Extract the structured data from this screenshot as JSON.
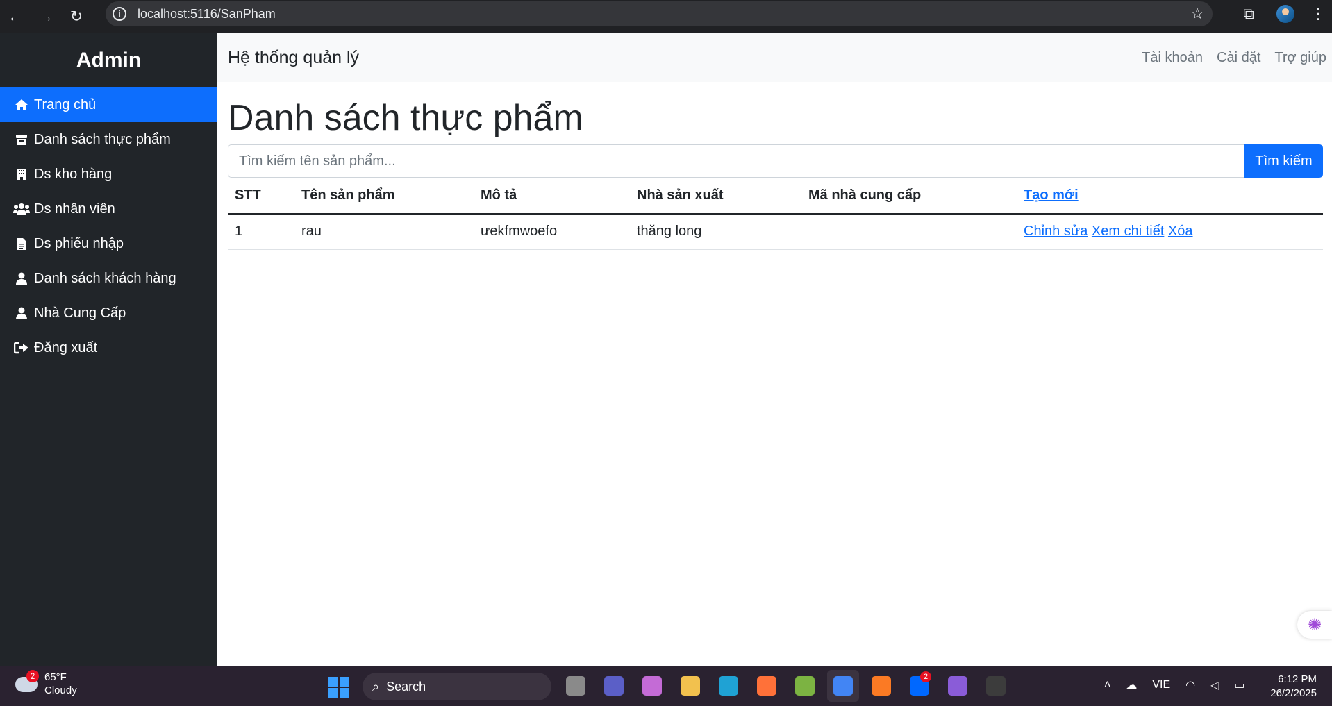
{
  "browser": {
    "url": "localhost:5116/SanPham",
    "icons": [
      "back-arrow-icon",
      "forward-arrow-icon",
      "reload-icon",
      "info-icon",
      "star-icon",
      "extensions-icon",
      "profile-avatar",
      "more-vert-icon"
    ]
  },
  "sidebar": {
    "brand": "Admin",
    "items": [
      {
        "label": "Trang chủ",
        "icon": "home-icon",
        "active": true
      },
      {
        "label": "Danh sách thực phẩm",
        "icon": "box-icon"
      },
      {
        "label": "Ds kho hàng",
        "icon": "building-icon"
      },
      {
        "label": "Ds nhân viên",
        "icon": "people-icon"
      },
      {
        "label": "Ds phiếu nhập",
        "icon": "document-icon"
      },
      {
        "label": "Danh sách khách hàng",
        "icon": "person-icon"
      },
      {
        "label": "Nhà Cung Cấp",
        "icon": "person-icon"
      },
      {
        "label": "Đăng xuất",
        "icon": "logout-icon"
      }
    ]
  },
  "topnav": {
    "title": "Hệ thống quản lý",
    "links": [
      "Tài khoản",
      "Cài đặt",
      "Trợ giúp"
    ]
  },
  "main": {
    "title": "Danh sách thực phẩm",
    "search": {
      "placeholder": "Tìm kiếm tên sản phẩm...",
      "value": "",
      "button": "Tìm kiếm"
    },
    "table": {
      "headers": [
        "STT",
        "Tên sản phẩm",
        "Mô tả",
        "Nhà sản xuất",
        "Mã nhà cung cấp"
      ],
      "create_link": "Tạo mới",
      "rows": [
        {
          "stt": "1",
          "ten": "rau",
          "mota": "ưekfmwoefo",
          "nsx": "thăng long",
          "ma_ncc": "",
          "actions": [
            "Chỉnh sửa",
            "Xem chi tiết",
            "Xóa"
          ]
        }
      ]
    }
  },
  "taskbar": {
    "weather": {
      "temp": "65°F",
      "condition": "Cloudy",
      "badge": "2"
    },
    "search_label": "Search",
    "apps": [
      {
        "name": "task-view-icon",
        "color": "#8a8a8a"
      },
      {
        "name": "teams-icon",
        "color": "#5b5fc7"
      },
      {
        "name": "copilot-icon",
        "color": "#c46bd6"
      },
      {
        "name": "file-explorer-icon",
        "color": "#f2c14e"
      },
      {
        "name": "edge-icon",
        "color": "#1fa2d4"
      },
      {
        "name": "firefox-icon",
        "color": "#ff7139"
      },
      {
        "name": "snipping-tool-icon",
        "color": "#7cb342"
      },
      {
        "name": "chrome-icon",
        "color": "#4285f4",
        "active": true
      },
      {
        "name": "xampp-icon",
        "color": "#fb7a24"
      },
      {
        "name": "zalo-icon",
        "color": "#0068ff",
        "badge": "2"
      },
      {
        "name": "visual-studio-icon",
        "color": "#8a5cd8"
      },
      {
        "name": "terminal-icon",
        "color": "#3c3c3c"
      }
    ],
    "tray": {
      "language": "VIE"
    },
    "clock": {
      "time": "6:12 PM",
      "date": "26/2/2025"
    }
  }
}
